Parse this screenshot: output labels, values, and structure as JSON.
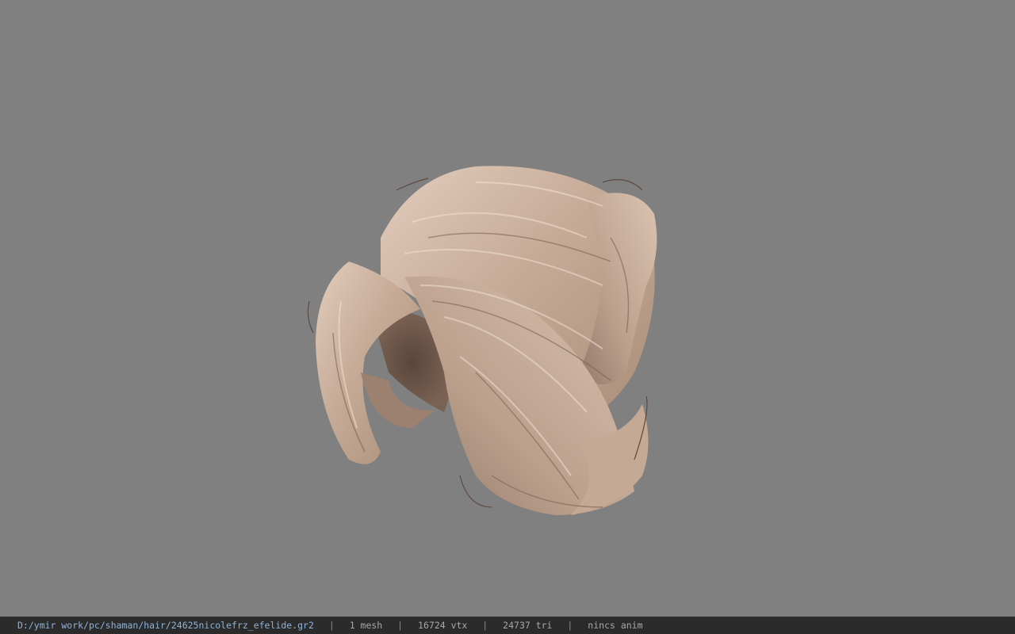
{
  "viewport": {
    "background_color": "#808080",
    "model_name": "hair-model",
    "hair_color_light": "#d9c2b0",
    "hair_color_mid": "#b89c88",
    "hair_color_dark": "#6b5547"
  },
  "statusbar": {
    "path": "D:/ymir work/pc/shaman/hair/24625nicolefrz_efelide.gr2",
    "separator": "|",
    "mesh_count": "1 mesh",
    "vertex_count": "16724 vtx",
    "triangle_count": "24737 tri",
    "anim_status": "nincs anim",
    "background_color": "#2b2b2b",
    "path_color": "#8fb3d9",
    "text_color": "#a8a8a8"
  }
}
